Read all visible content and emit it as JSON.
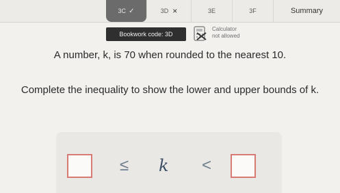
{
  "tabs": [
    {
      "label": "3C",
      "state": "done"
    },
    {
      "label": "3D",
      "mark": "×"
    },
    {
      "label": "3E"
    },
    {
      "label": "3F"
    },
    {
      "label": "Summary"
    }
  ],
  "bookwork": {
    "label": "Bookwork code: 3D"
  },
  "calculator": {
    "line1": "Calculator",
    "line2": "not allowed"
  },
  "question": "A number, k, is 70 when rounded to the nearest 10.",
  "instruction": "Complete the inequality to show the lower and upper bounds of k.",
  "inequality": {
    "le": "≤",
    "variable": "k",
    "lt": "<"
  }
}
